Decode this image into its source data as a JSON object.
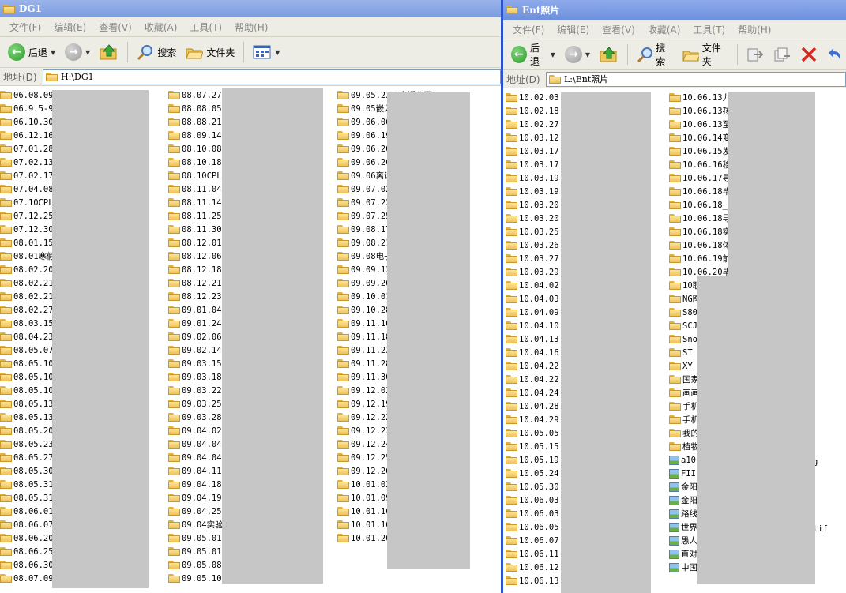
{
  "window1": {
    "title": "DG1",
    "menu": [
      "文件(F)",
      "编辑(E)",
      "查看(V)",
      "收藏(A)",
      "工具(T)",
      "帮助(H)"
    ],
    "toolbar": {
      "back": "后退",
      "search": "搜索",
      "folders": "文件夹"
    },
    "address_label": "地址(D)",
    "address": "H:\\DG1",
    "columns": [
      [
        "06.08.09",
        "06.9.5-9",
        "06.10.30",
        "06.12.16",
        "07.01.28",
        "07.02.13",
        "07.02.17",
        "07.04.08",
        "07.10CPL",
        "07.12.25",
        "07.12.30",
        "08.01.15",
        "08.01寒假",
        "08.02.20",
        "08.02.21",
        "08.02.21",
        "08.02.27",
        "08.03.15",
        "08.04.23",
        "08.05.07",
        "08.05.10",
        "08.05.10",
        "08.05.10",
        "08.05.13",
        "08.05.13",
        "08.05.20",
        "08.05.23",
        "08.05.27",
        "08.05.30",
        "08.05.31",
        "08.05.31",
        "08.06.01",
        "08.06.07",
        "08.06.20",
        "08.06.25",
        "08.06.30",
        "08.07.09"
      ],
      [
        "08.07.27",
        "08.08.05",
        "08.08.21",
        "08.09.14",
        "08.10.08",
        "08.10.18",
        "08.10CPL",
        "08.11.04",
        "08.11.14",
        "08.11.25",
        "08.11.30",
        "08.12.01",
        "08.12.06",
        "08.12.18",
        "08.12.21",
        "08.12.23",
        "09.01.04",
        "09.01.24",
        "09.02.06",
        "09.02.14",
        "09.03.15",
        "09.03.18",
        "09.03.22",
        "09.03.25",
        "09.03.28",
        "09.04.02",
        "09.04.04",
        "09.04.04",
        "09.04.11",
        "09.04.18",
        "09.04.19",
        "09.04.25",
        "09.04实验",
        "09.05.01",
        "09.05.01",
        "09.05.08",
        "09.05.10"
      ],
      [
        "09.05.23五宫湖公园",
        "09.05嵌入",
        "09.06.06",
        "09.06.19",
        "09.06.20",
        "09.06.26",
        "09.06离访",
        "09.07.02",
        "09.07.22",
        "09.07.25",
        "09.08.17",
        "09.08.21",
        "09.08电子",
        "09.09.13",
        "09.09.26",
        "09.10.01",
        "09.10.28",
        "09.11.16",
        "09.11.18",
        "09.11.23",
        "09.11.28",
        "09.11.30",
        "09.12.02",
        "09.12.19",
        "09.12.22",
        "09.12.23",
        "09.12.24",
        "09.12.25",
        "09.12.26",
        "10.01.02",
        "10.01.09",
        "10.01.16",
        "10.01.16",
        "10.01.26"
      ]
    ]
  },
  "window2": {
    "title": "Ent照片",
    "menu": [
      "文件(F)",
      "编辑(E)",
      "查看(V)",
      "收藏(A)",
      "工具(T)",
      "帮助(H)"
    ],
    "toolbar": {
      "back": "后退",
      "search": "搜索",
      "folders": "文件夹"
    },
    "address_label": "地址(D)",
    "address": "L:\\Ent照片",
    "columns": [
      [
        "10.02.03",
        "10.02.18",
        "10.02.27",
        "10.03.12",
        "10.03.17",
        "10.03.17",
        "10.03.19",
        "10.03.19",
        "10.03.20",
        "10.03.20",
        "10.03.25",
        "10.03.26",
        "10.03.27",
        "10.03.29",
        "10.04.02",
        "10.04.03",
        "10.04.09",
        "10.04.10",
        "10.04.13",
        "10.04.16",
        "10.04.22",
        "10.04.22",
        "10.04.24",
        "10.04.28",
        "10.04.29",
        "10.05.05",
        "10.05.15",
        "10.05.19",
        "10.05.24",
        "10.05.30",
        "10.06.03",
        "10.06.03",
        "10.06.05",
        "10.06.07",
        "10.06.11",
        "10.06.12",
        "10.06.13"
      ],
      [
        "10.06.13九",
        "10.06.13孩",
        "10.06.13至",
        "10.06.14变",
        "10.06.15发",
        "10.06.16移",
        "10.06.17导",
        "10.06.18毕",
        "10.06.18_",
        "10.06.18寻",
        "10.06.18实",
        "10.06.18体",
        "10.06.19前",
        "10.06.20毕",
        "10职",
        "NG图",
        "S80",
        "SCJ",
        "Sno",
        "ST",
        "XY",
        "国家",
        "画画",
        "手机",
        "手机",
        "我的",
        "植物"
      ],
      [
        "a10",
        "FII",
        "金阳",
        "金阳",
        "路线",
        "世界",
        "愚人",
        "直对",
        "中国"
      ]
    ],
    "image_file_suffixes": [
      "g",
      "tif"
    ]
  }
}
